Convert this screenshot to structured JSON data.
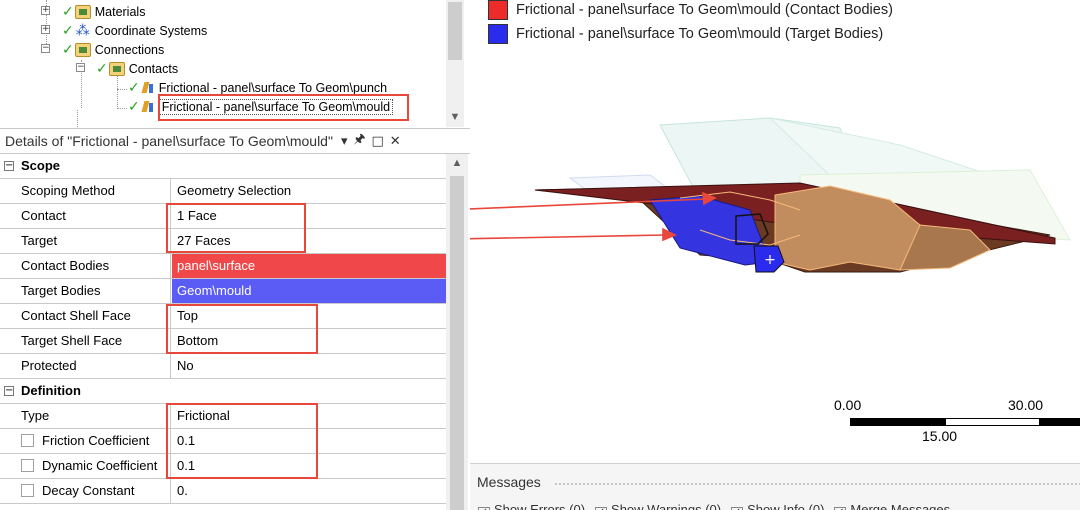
{
  "tree": {
    "items": [
      {
        "label": "Materials"
      },
      {
        "label": "Coordinate Systems"
      },
      {
        "label": "Connections"
      },
      {
        "label": "Contacts"
      },
      {
        "label": "Frictional - panel\\surface To Geom\\punch"
      },
      {
        "label": "Frictional - panel\\surface To Geom\\mould"
      }
    ]
  },
  "details": {
    "title": "Details of \"Frictional - panel\\surface To Geom\\mould\"",
    "header_buttons": {
      "dropdown": "▾",
      "pin": "🖈",
      "maximize": "□",
      "close": "✕"
    },
    "sections": [
      {
        "label": "Scope",
        "rows": [
          {
            "name": "Scoping Method",
            "value": "Geometry Selection"
          },
          {
            "name": "Contact",
            "value": "1 Face"
          },
          {
            "name": "Target",
            "value": "27 Faces"
          },
          {
            "name": "Contact Bodies",
            "value": "panel\\surface"
          },
          {
            "name": "Target Bodies",
            "value": "Geom\\mould"
          },
          {
            "name": "Contact Shell Face",
            "value": "Top"
          },
          {
            "name": "Target Shell Face",
            "value": "Bottom"
          },
          {
            "name": "Protected",
            "value": "No"
          }
        ]
      },
      {
        "label": "Definition",
        "rows": [
          {
            "name": "Type",
            "value": "Frictional"
          },
          {
            "name": "Friction Coefficient",
            "value": "0.1"
          },
          {
            "name": "Dynamic Coefficient",
            "value": "0.1"
          },
          {
            "name": "Decay Constant",
            "value": "0."
          }
        ]
      }
    ]
  },
  "graphics": {
    "legend": [
      {
        "label": "Frictional - panel\\surface To Geom\\mould (Contact Bodies)",
        "color": "#ee2b2b"
      },
      {
        "label": "Frictional - panel\\surface To Geom\\mould (Target Bodies)",
        "color": "#2b2bee"
      }
    ],
    "scale": {
      "left": "0.00",
      "right": "30.00",
      "mid": "15.00"
    }
  },
  "messages": {
    "title": "Messages",
    "options": [
      "Show Errors (0)",
      "Show Warnings (0)",
      "Show Info (0)",
      "Merge Messages"
    ]
  },
  "colors": {
    "contact_bodies": "#f0484a",
    "target_bodies": "#5b5bf5",
    "annotation": "#e8473c"
  }
}
